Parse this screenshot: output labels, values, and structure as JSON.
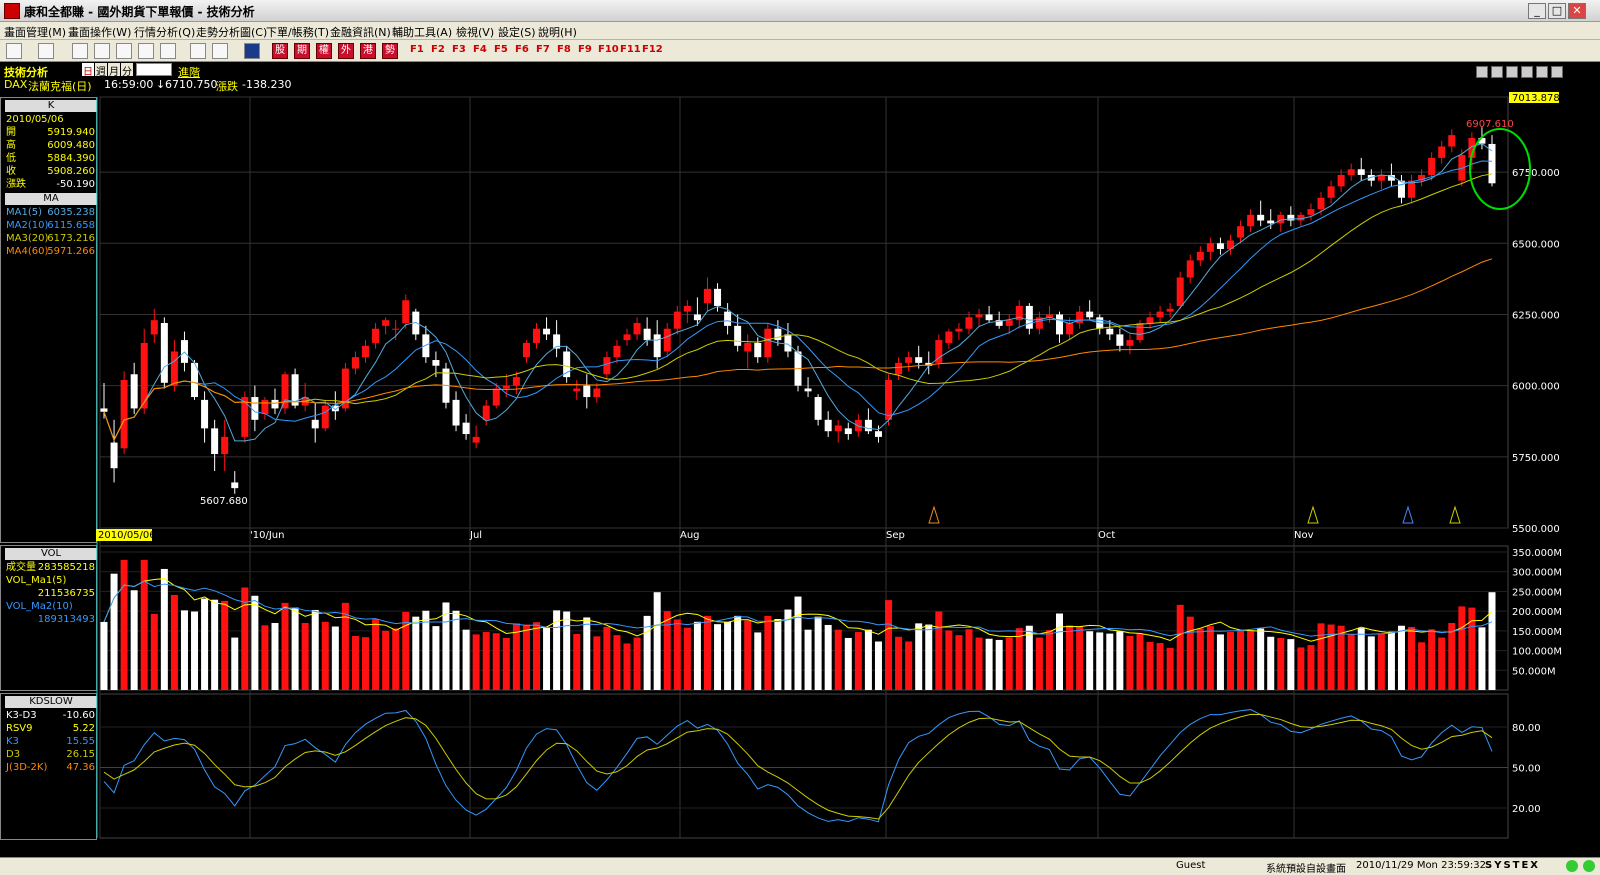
{
  "window": {
    "title": "康和全都賺 - 國外期貨下單報價 - 技術分析",
    "min": "_",
    "max": "□",
    "close": "✕"
  },
  "menu": [
    "畫面管理(M)",
    "畫面操作(W)",
    "行情分析(Q)",
    "走勢分析圖(C)",
    "下單/帳務(T)",
    "金融資訊(N)",
    "輔助工具(A)",
    "檢視(V)",
    "設定(S)",
    "說明(H)"
  ],
  "toolbar": {
    "red_buttons": [
      "股",
      "期",
      "權",
      "外",
      "港",
      "勢"
    ],
    "fkeys": [
      "F1",
      "F2",
      "F3",
      "F4",
      "F5",
      "F6",
      "F7",
      "F8",
      "F9",
      "F10",
      "F11",
      "F12"
    ]
  },
  "header": {
    "module": "技術分析",
    "period_options": [
      "日",
      "週",
      "月",
      "分"
    ],
    "advanced": "進階",
    "symbol": "DAX",
    "name": "法蘭克福(日)",
    "time": "16:59:00",
    "arrow": "↓",
    "last": "6710.750",
    "change_label": "漲跌",
    "change": "-138.230"
  },
  "k_panel": {
    "title": "K",
    "date": "2010/05/06",
    "rows": [
      {
        "k": "開",
        "v": "5919.940"
      },
      {
        "k": "高",
        "v": "6009.480"
      },
      {
        "k": "低",
        "v": "5884.390"
      },
      {
        "k": "收",
        "v": "5908.260"
      },
      {
        "k": "漲跌",
        "v": "-50.190"
      }
    ]
  },
  "ma_panel": {
    "title": "MA",
    "rows": [
      {
        "k": "MA1(5)",
        "v": "6035.238",
        "c": "#5ad"
      },
      {
        "k": "MA2(10)",
        "v": "6115.658",
        "c": "#39f"
      },
      {
        "k": "MA3(20)",
        "v": "6173.216",
        "c": "#cc0"
      },
      {
        "k": "MA4(60)",
        "v": "5971.266",
        "c": "#f80"
      }
    ]
  },
  "vol_panel": {
    "title": "VOL",
    "rows": [
      {
        "k": "成交量",
        "v": "283585218",
        "c": "#ff0"
      },
      {
        "k": "VOL_Ma1(5)",
        "v": "",
        "c": "#ff0"
      },
      {
        "k": "",
        "v": "211536735",
        "c": "#ff0"
      },
      {
        "k": "VOL_Ma2(10)",
        "v": "",
        "c": "#39f"
      },
      {
        "k": "",
        "v": "189313493",
        "c": "#39f"
      }
    ]
  },
  "kd_panel": {
    "title": "KDSLOW",
    "rows": [
      {
        "k": "K3-D3",
        "v": "-10.60",
        "c": "#fff"
      },
      {
        "k": "RSV9",
        "v": "5.22",
        "c": "#ff0"
      },
      {
        "k": "K3",
        "v": "15.55",
        "c": "#39f"
      },
      {
        "k": "D3",
        "v": "26.15",
        "c": "#cc0"
      },
      {
        "k": "J(3D-2K)",
        "v": "47.36",
        "c": "#f80"
      }
    ]
  },
  "chart_data": {
    "type": "candlestick",
    "price_axis": {
      "ticks": [
        "7013.878",
        "6750.000",
        "6500.000",
        "6250.000",
        "6000.000",
        "5750.000",
        "5500.000"
      ],
      "ylim": [
        5500,
        7013.878
      ]
    },
    "x_labels": [
      "2010/05/06",
      "'10/Jun",
      "Jul",
      "Aug",
      "Sep",
      "Oct",
      "Nov"
    ],
    "annotations": {
      "high": "6907.610",
      "low": "5607.680"
    },
    "candles": [
      [
        5919.94,
        6009.48,
        5884.39,
        5908.26
      ],
      [
        5800,
        5880,
        5660,
        5710
      ],
      [
        5780,
        6050,
        5760,
        6020
      ],
      [
        6040,
        6080,
        5900,
        5920
      ],
      [
        5920,
        6200,
        5900,
        6150
      ],
      [
        6180,
        6270,
        6150,
        6230
      ],
      [
        6220,
        6240,
        5990,
        6010
      ],
      [
        6000,
        6160,
        5980,
        6120
      ],
      [
        6160,
        6190,
        6050,
        6080
      ],
      [
        6080,
        6090,
        5950,
        5960
      ],
      [
        5950,
        5980,
        5800,
        5850
      ],
      [
        5850,
        5880,
        5700,
        5760
      ],
      [
        5760,
        5880,
        5700,
        5820
      ],
      [
        5660,
        5700,
        5620,
        5640
      ],
      [
        5820,
        5980,
        5800,
        5960
      ],
      [
        5960,
        6000,
        5840,
        5880
      ],
      [
        5900,
        5960,
        5880,
        5950
      ],
      [
        5950,
        5990,
        5900,
        5920
      ],
      [
        5920,
        6050,
        5900,
        6040
      ],
      [
        6040,
        6060,
        5920,
        5930
      ],
      [
        5930,
        6010,
        5910,
        5960
      ],
      [
        5880,
        5940,
        5800,
        5850
      ],
      [
        5850,
        5950,
        5840,
        5930
      ],
      [
        5930,
        5980,
        5880,
        5910
      ],
      [
        5920,
        6080,
        5910,
        6060
      ],
      [
        6060,
        6120,
        6040,
        6100
      ],
      [
        6100,
        6160,
        6080,
        6140
      ],
      [
        6150,
        6220,
        6130,
        6200
      ],
      [
        6210,
        6240,
        6180,
        6230
      ],
      [
        6200,
        6230,
        6160,
        6200
      ],
      [
        6220,
        6320,
        6200,
        6300
      ],
      [
        6260,
        6270,
        6160,
        6180
      ],
      [
        6180,
        6210,
        6080,
        6100
      ],
      [
        6090,
        6120,
        6030,
        6070
      ],
      [
        6060,
        6080,
        5920,
        5940
      ],
      [
        5950,
        5980,
        5840,
        5860
      ],
      [
        5870,
        5900,
        5810,
        5830
      ],
      [
        5800,
        5860,
        5780,
        5820
      ],
      [
        5880,
        5950,
        5860,
        5930
      ],
      [
        5930,
        6010,
        5920,
        5990
      ],
      [
        5990,
        6040,
        5960,
        6000
      ],
      [
        6000,
        6050,
        5970,
        6030
      ],
      [
        6100,
        6160,
        6080,
        6150
      ],
      [
        6150,
        6220,
        6130,
        6200
      ],
      [
        6200,
        6240,
        6160,
        6180
      ],
      [
        6180,
        6230,
        6100,
        6130
      ],
      [
        6120,
        6140,
        6010,
        6030
      ],
      [
        5980,
        6020,
        5950,
        5990
      ],
      [
        6000,
        6040,
        5920,
        5960
      ],
      [
        5960,
        6010,
        5940,
        5990
      ],
      [
        6040,
        6120,
        6020,
        6100
      ],
      [
        6100,
        6160,
        6080,
        6140
      ],
      [
        6160,
        6200,
        6140,
        6180
      ],
      [
        6180,
        6240,
        6160,
        6220
      ],
      [
        6200,
        6240,
        6140,
        6160
      ],
      [
        6180,
        6230,
        6060,
        6100
      ],
      [
        6120,
        6220,
        6100,
        6200
      ],
      [
        6200,
        6280,
        6180,
        6260
      ],
      [
        6260,
        6300,
        6220,
        6280
      ],
      [
        6250,
        6310,
        6210,
        6230
      ],
      [
        6290,
        6380,
        6260,
        6340
      ],
      [
        6340,
        6360,
        6260,
        6280
      ],
      [
        6260,
        6290,
        6180,
        6210
      ],
      [
        6210,
        6250,
        6120,
        6140
      ],
      [
        6120,
        6180,
        6060,
        6150
      ],
      [
        6150,
        6170,
        6080,
        6100
      ],
      [
        6100,
        6220,
        6080,
        6200
      ],
      [
        6200,
        6230,
        6140,
        6160
      ],
      [
        6180,
        6220,
        6100,
        6120
      ],
      [
        6120,
        6140,
        5980,
        6000
      ],
      [
        5990,
        6030,
        5960,
        5980
      ],
      [
        5960,
        5970,
        5860,
        5880
      ],
      [
        5880,
        5910,
        5820,
        5840
      ],
      [
        5840,
        5880,
        5800,
        5860
      ],
      [
        5850,
        5870,
        5810,
        5830
      ],
      [
        5840,
        5900,
        5820,
        5880
      ],
      [
        5880,
        5920,
        5830,
        5840
      ],
      [
        5840,
        5860,
        5800,
        5820
      ],
      [
        5880,
        6040,
        5860,
        6020
      ],
      [
        6040,
        6100,
        6020,
        6080
      ],
      [
        6080,
        6120,
        6050,
        6100
      ],
      [
        6100,
        6140,
        6060,
        6080
      ],
      [
        6080,
        6120,
        6040,
        6070
      ],
      [
        6080,
        6180,
        6060,
        6160
      ],
      [
        6150,
        6200,
        6130,
        6190
      ],
      [
        6190,
        6220,
        6160,
        6200
      ],
      [
        6200,
        6260,
        6180,
        6240
      ],
      [
        6240,
        6270,
        6210,
        6250
      ],
      [
        6250,
        6280,
        6220,
        6230
      ],
      [
        6230,
        6260,
        6200,
        6210
      ],
      [
        6210,
        6250,
        6180,
        6230
      ],
      [
        6230,
        6300,
        6200,
        6280
      ],
      [
        6280,
        6290,
        6180,
        6200
      ],
      [
        6200,
        6260,
        6180,
        6240
      ],
      [
        6240,
        6280,
        6220,
        6250
      ],
      [
        6250,
        6260,
        6150,
        6180
      ],
      [
        6180,
        6240,
        6160,
        6220
      ],
      [
        6220,
        6280,
        6200,
        6260
      ],
      [
        6260,
        6300,
        6230,
        6240
      ],
      [
        6240,
        6250,
        6180,
        6200
      ],
      [
        6200,
        6230,
        6160,
        6180
      ],
      [
        6180,
        6200,
        6120,
        6140
      ],
      [
        6140,
        6180,
        6110,
        6160
      ],
      [
        6160,
        6230,
        6150,
        6220
      ],
      [
        6220,
        6260,
        6200,
        6240
      ],
      [
        6240,
        6280,
        6220,
        6260
      ],
      [
        6260,
        6290,
        6240,
        6270
      ],
      [
        6280,
        6400,
        6270,
        6380
      ],
      [
        6380,
        6460,
        6360,
        6440
      ],
      [
        6440,
        6490,
        6420,
        6470
      ],
      [
        6470,
        6520,
        6440,
        6500
      ],
      [
        6500,
        6520,
        6460,
        6480
      ],
      [
        6480,
        6530,
        6460,
        6510
      ],
      [
        6520,
        6580,
        6500,
        6560
      ],
      [
        6560,
        6620,
        6540,
        6600
      ],
      [
        6600,
        6650,
        6560,
        6580
      ],
      [
        6580,
        6620,
        6550,
        6570
      ],
      [
        6570,
        6610,
        6540,
        6600
      ],
      [
        6600,
        6630,
        6560,
        6580
      ],
      [
        6580,
        6610,
        6560,
        6600
      ],
      [
        6600,
        6640,
        6580,
        6620
      ],
      [
        6620,
        6680,
        6600,
        6660
      ],
      [
        6660,
        6720,
        6640,
        6700
      ],
      [
        6700,
        6760,
        6680,
        6740
      ],
      [
        6740,
        6780,
        6720,
        6760
      ],
      [
        6760,
        6800,
        6720,
        6740
      ],
      [
        6740,
        6760,
        6700,
        6720
      ],
      [
        6720,
        6760,
        6690,
        6740
      ],
      [
        6740,
        6780,
        6700,
        6720
      ],
      [
        6720,
        6740,
        6640,
        6660
      ],
      [
        6660,
        6740,
        6640,
        6720
      ],
      [
        6720,
        6760,
        6700,
        6740
      ],
      [
        6740,
        6820,
        6720,
        6800
      ],
      [
        6800,
        6860,
        6780,
        6840
      ],
      [
        6840,
        6900,
        6820,
        6880
      ],
      [
        6720,
        6830,
        6700,
        6810
      ],
      [
        6800,
        6890,
        6760,
        6870
      ],
      [
        6870,
        6907.61,
        6830,
        6850
      ],
      [
        6848.98,
        6880,
        6700,
        6710.75
      ]
    ],
    "vol_axis": {
      "ticks": [
        "350.000M",
        "300.000M",
        "250.000M",
        "200.000M",
        "150.000M",
        "100.000M",
        "50.000M"
      ],
      "ylim": [
        0,
        350
      ]
    },
    "kd_axis": {
      "ticks": [
        "80.00",
        "50.00",
        "20.00"
      ],
      "ylim": [
        0,
        100
      ]
    }
  },
  "status": {
    "user": "Guest",
    "layout": "系統預設自設畫面",
    "datetime": "2010/11/29 Mon 23:59:32",
    "brand": "SYSTEX"
  }
}
